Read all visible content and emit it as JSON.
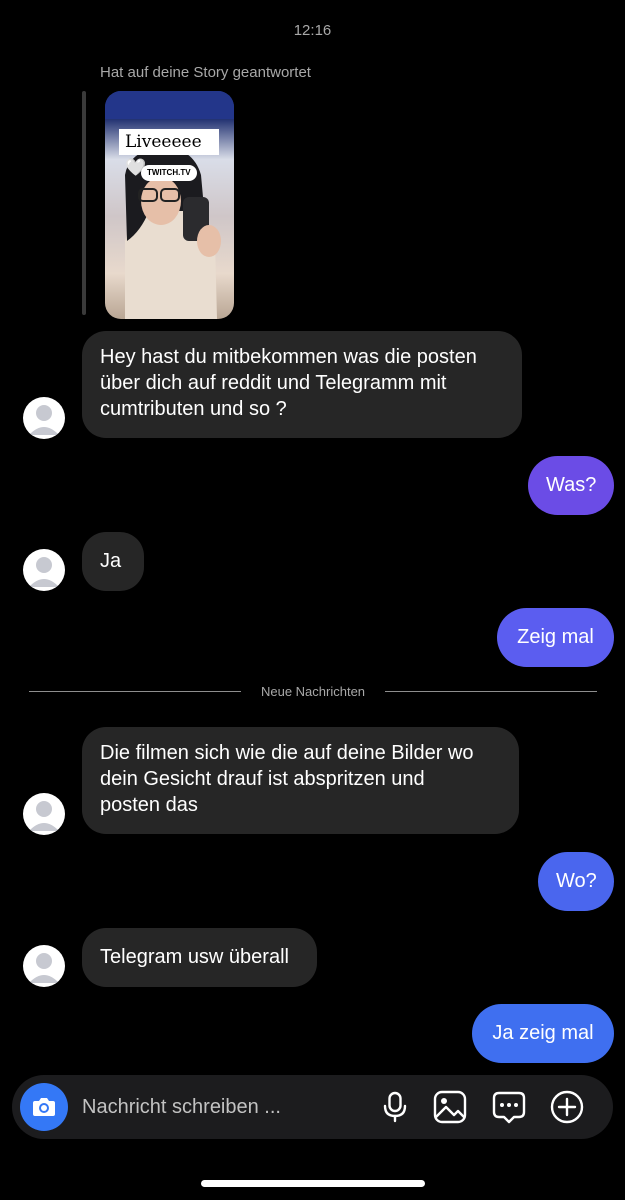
{
  "timestamp": "12:16",
  "story_reply": {
    "caption": "Hat auf deine Story geantwortet",
    "label": "Liveeeee 🤍",
    "link": "TWITCH.TV"
  },
  "messages": [
    {
      "direction": "incoming",
      "text": "Hey hast du mitbekommen was die posten\nüber dich auf reddit und Telegramm mit\ncumtributen und so ?"
    },
    {
      "direction": "outgoing",
      "text": "Was?"
    },
    {
      "direction": "incoming",
      "text": "Ja"
    },
    {
      "direction": "outgoing",
      "text": "Zeig mal"
    },
    {
      "direction": "incoming",
      "text": "Die filmen sich wie die auf deine Bilder wo\ndein Gesicht drauf ist  abspritzen und\nposten das"
    },
    {
      "direction": "outgoing",
      "text": "Wo?"
    },
    {
      "direction": "incoming",
      "text": "Telegram usw überall"
    },
    {
      "direction": "outgoing",
      "text": "Ja zeig mal"
    }
  ],
  "divider": {
    "label": "Neue Nachrichten"
  },
  "composer": {
    "placeholder": "Nachricht schreiben ...",
    "icons": [
      "camera-icon",
      "microphone-icon",
      "image-icon",
      "sticker-icon",
      "plus-circle-icon"
    ]
  },
  "colors": {
    "background": "#000000",
    "incoming_bubble": "#262626",
    "outgoing_purple": "#6b4ce6",
    "outgoing_indigo": "#5b5df0",
    "outgoing_blue": "#3f6ff0",
    "camera_button": "#3478f6"
  }
}
